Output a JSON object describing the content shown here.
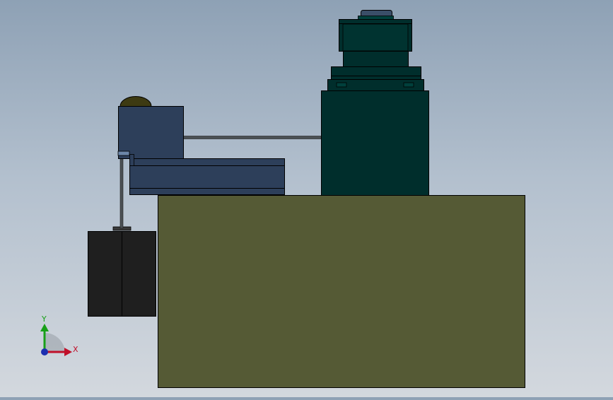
{
  "viewport": {
    "background_top": "#8ea1b5",
    "background_bottom": "#d3d8de"
  },
  "colors": {
    "base_block": "#555a35",
    "motor_body": "#002e2c",
    "arm": "#2d3f5a",
    "weight_block": "#1f1f1f",
    "dome": "#3d3a12",
    "outline": "#000000"
  },
  "triad": {
    "x_label": "X",
    "y_label": "Y",
    "x_color": "#c0102a",
    "y_color": "#18a018",
    "z_color": "#1c2fb0"
  }
}
